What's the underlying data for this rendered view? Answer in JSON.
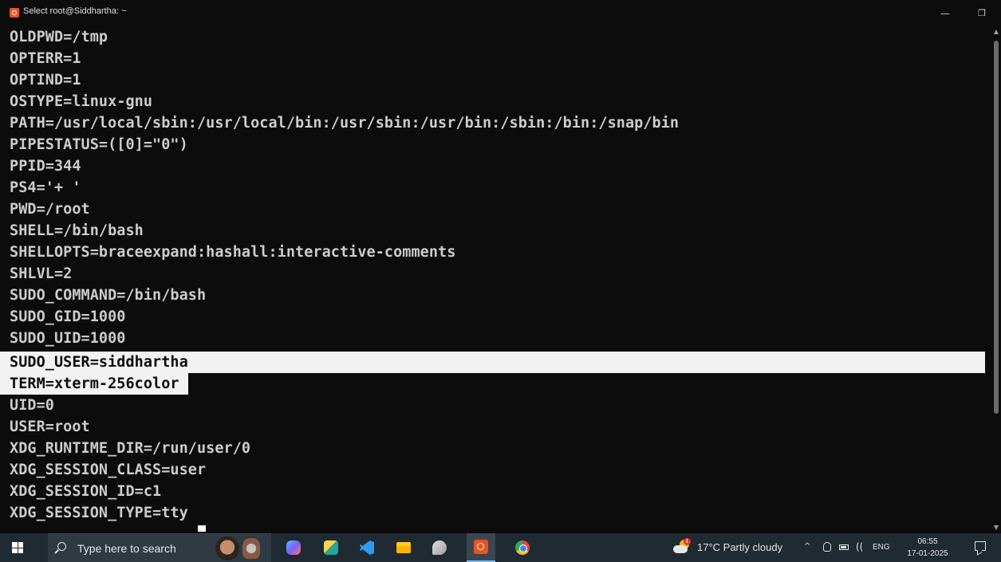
{
  "window": {
    "title": "Select root@Siddhartha: ~",
    "controls": {
      "minimize": "—",
      "maximize": "❐",
      "close": "✕"
    }
  },
  "terminal": {
    "lines": [
      "OLDPWD=/tmp",
      "OPTERR=1",
      "OPTIND=1",
      "OSTYPE=linux-gnu",
      "PATH=/usr/local/sbin:/usr/local/bin:/usr/sbin:/usr/bin:/sbin:/bin:/snap/bin",
      "PIPESTATUS=([0]=\"0\")",
      "PPID=344",
      "PS4='+ '",
      "PWD=/root",
      "SHELL=/bin/bash",
      "SHELLOPTS=braceexpand:hashall:interactive-comments",
      "SHLVL=2",
      "SUDO_COMMAND=/bin/bash",
      "SUDO_GID=1000",
      "SUDO_UID=1000",
      "SUDO_USER=siddhartha",
      "TERM=xterm-256color ",
      "UID=0",
      "USER=root",
      "XDG_RUNTIME_DIR=/run/user/0",
      "XDG_SESSION_CLASS=user",
      "XDG_SESSION_ID=c1",
      "XDG_SESSION_TYPE=tty"
    ],
    "selected_lines": [
      15,
      16
    ],
    "colors": {
      "background": "#0c0c0c",
      "text": "#cccccc",
      "selection": "#f2f2f2"
    }
  },
  "scrollbar": {
    "up": "▲",
    "down": "▼"
  },
  "taskbar": {
    "search_placeholder": "Type here to search",
    "pinned_icons": [
      "copilot-icon",
      "sway-icon",
      "vscode-icon",
      "file-explorer-icon",
      "paint-icon",
      "ubuntu-icon",
      "chrome-icon"
    ],
    "active_app": "ubuntu-icon",
    "weather": {
      "badge": "1",
      "text": "17°C  Partly cloudy"
    },
    "tray": {
      "chevron": "^",
      "wifi": "((",
      "language": "ENG",
      "time": "06:55",
      "date": "17-01-2025"
    }
  }
}
